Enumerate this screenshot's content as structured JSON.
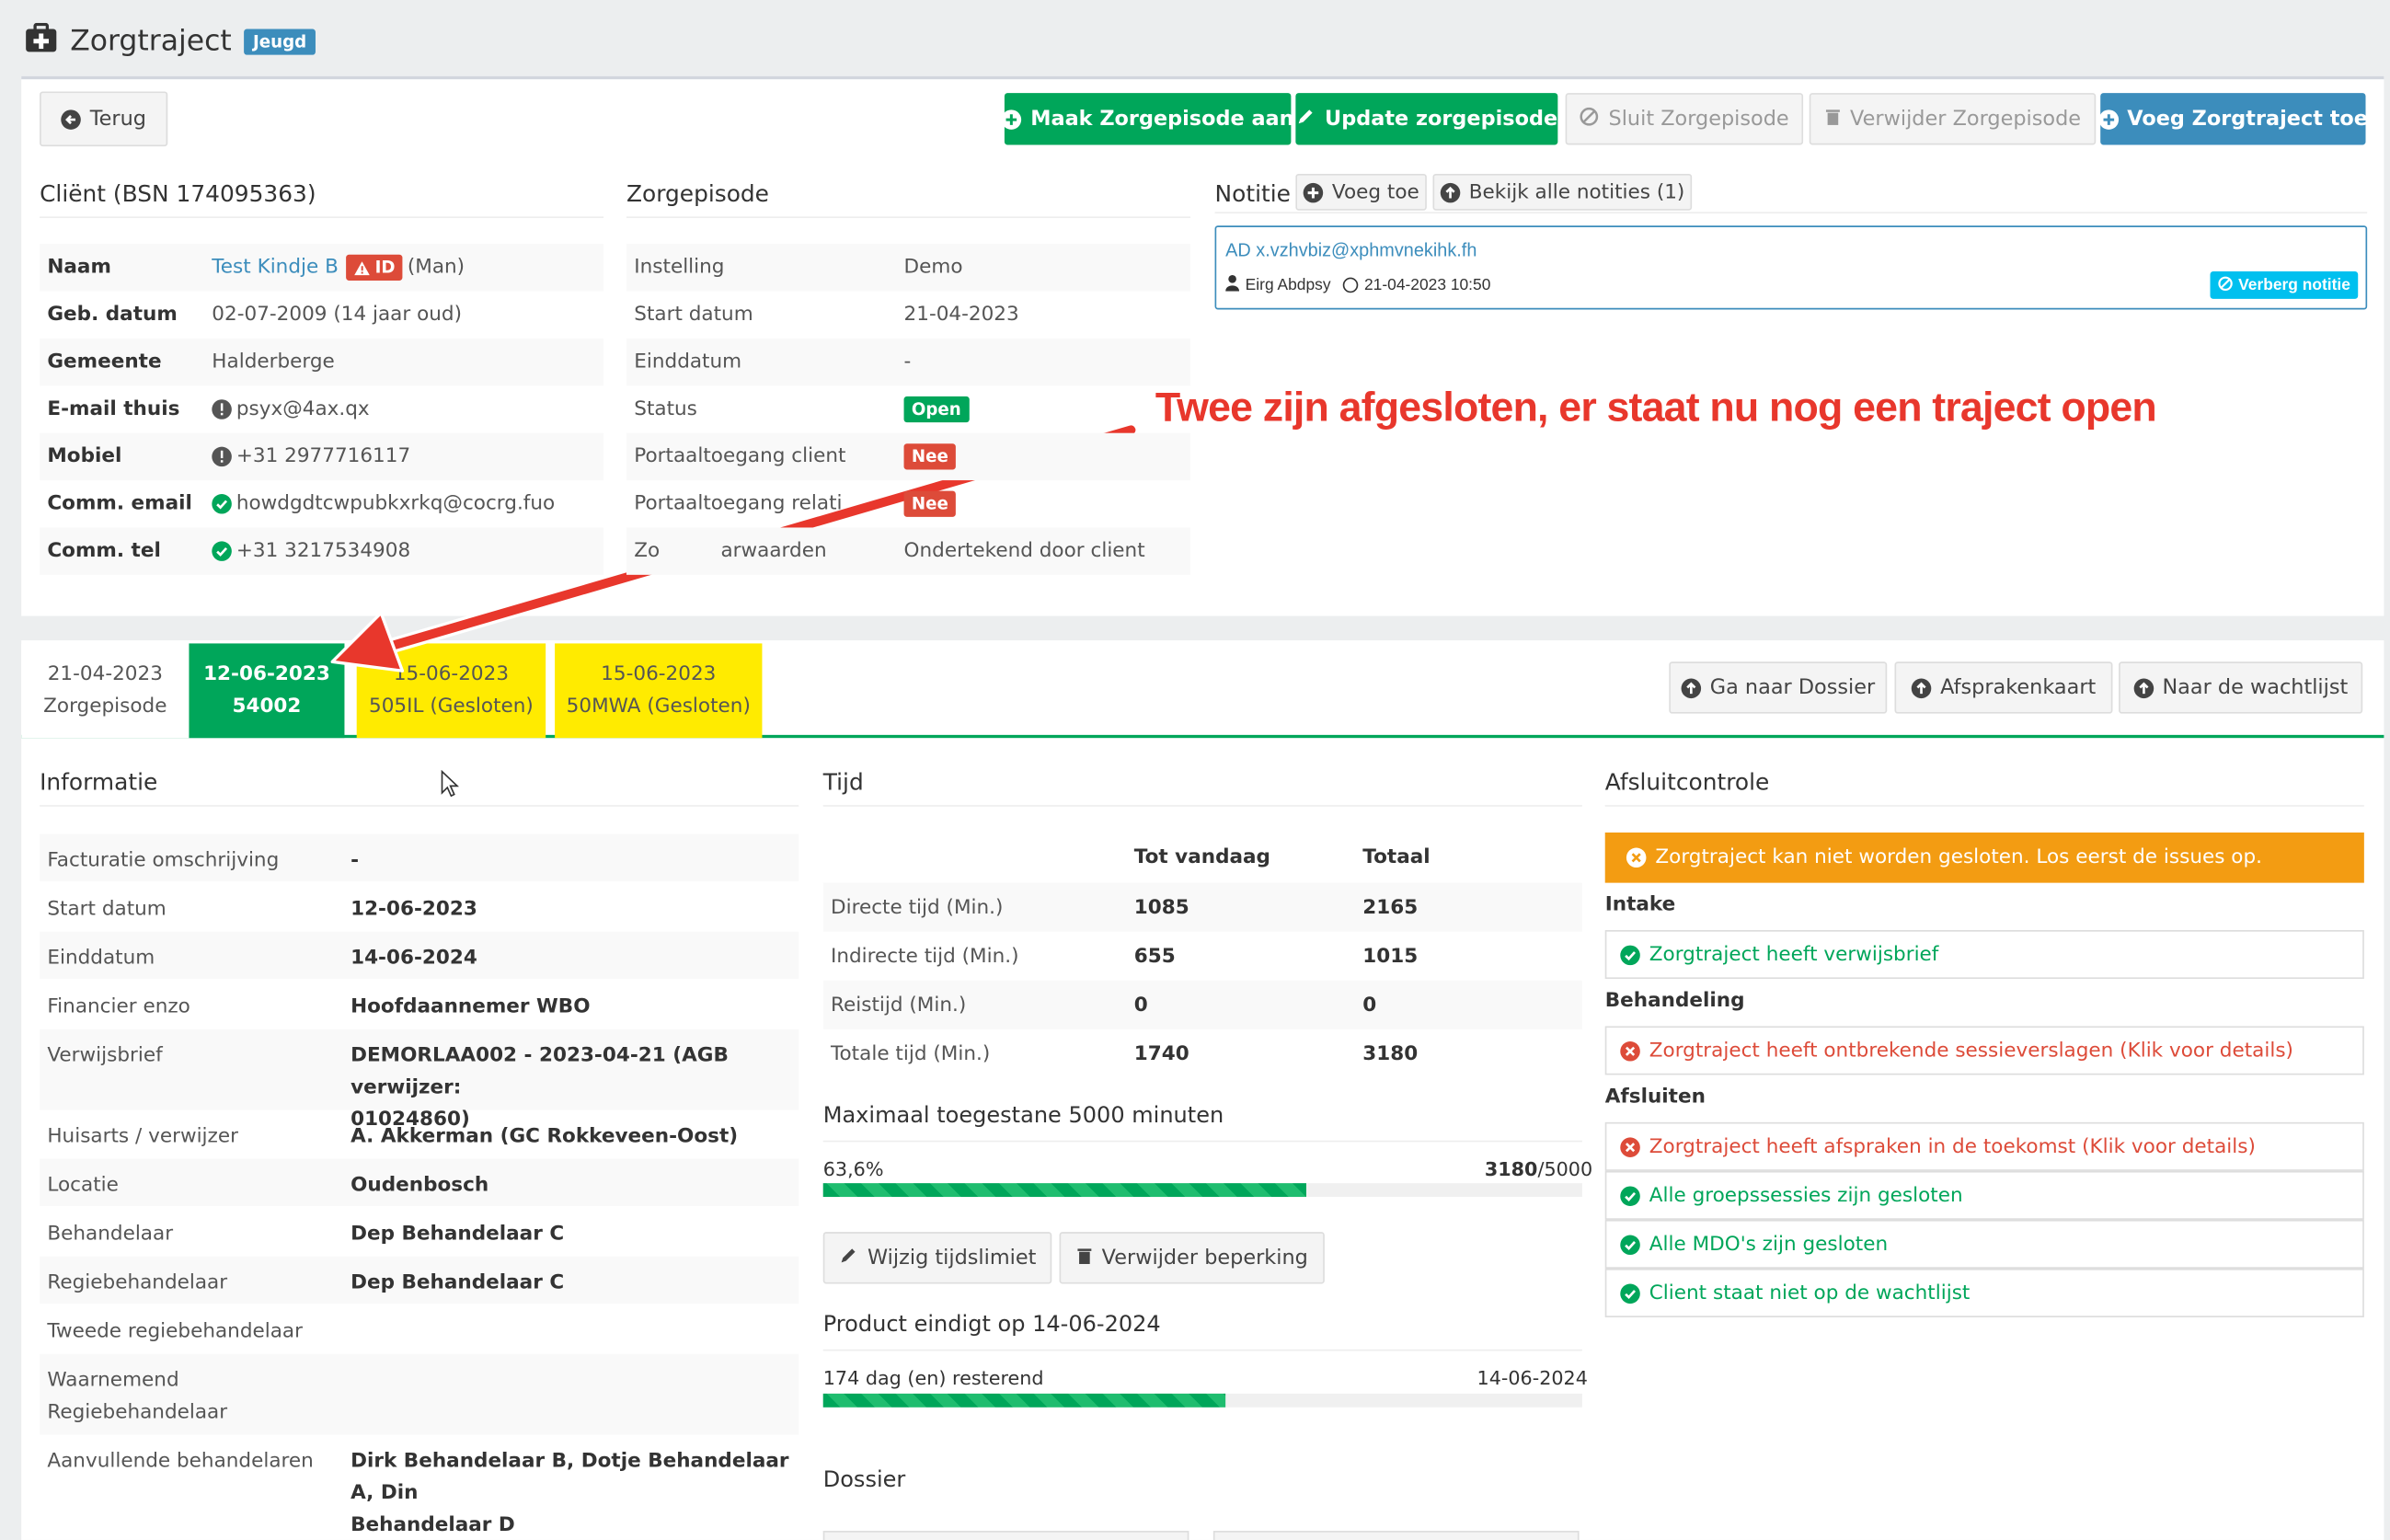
{
  "header": {
    "title": "Zorgtraject",
    "badge": "Jeugd"
  },
  "toolbar": {
    "back": "Terug",
    "create_episode": "Maak Zorgepisode aan",
    "update_episode": "Update zorgepisode",
    "close_episode": "Sluit Zorgepisode",
    "delete_episode": "Verwijder Zorgepisode",
    "add_trajectory": "Voeg Zorgtraject toe"
  },
  "client": {
    "title": "Cliënt (BSN 174095363)",
    "rows": [
      {
        "key": "Naam",
        "value": "Test Kindje B",
        "badge": "ID",
        "extra": "(Man)"
      },
      {
        "key": "Geb. datum",
        "value": "02-07-2009 (14 jaar oud)"
      },
      {
        "key": "Gemeente",
        "value": "Halderberge"
      },
      {
        "key": "E-mail thuis",
        "value": "psyx@4ax.qx"
      },
      {
        "key": "Mobiel",
        "value": "+31 2977716117"
      },
      {
        "key": "Comm. email",
        "value": "howdgdtcwpubkxrkq@cocrg.fuo"
      },
      {
        "key": "Comm. tel",
        "value": "+31 3217534908"
      }
    ]
  },
  "episode": {
    "title": "Zorgepisode",
    "rows": [
      {
        "key": "Instelling",
        "value": "Demo"
      },
      {
        "key": "Start datum",
        "value": "21-04-2023"
      },
      {
        "key": "Einddatum",
        "value": "-"
      },
      {
        "key": "Status",
        "value": "Open"
      },
      {
        "key": "Portaaltoegang client",
        "value": "Nee"
      },
      {
        "key": "Portaaltoegang relati",
        "value": "Nee"
      },
      {
        "key": "Zo",
        "key2": "arwaarden",
        "value": "Ondertekend door client"
      }
    ]
  },
  "notes": {
    "title": "Notitie",
    "add": "Voeg toe",
    "view_all": "Bekijk alle notities (1)",
    "note_text": "AD x.vzhvbiz@xphmvnekihk.fh",
    "note_author": "Eirg Abdpsy",
    "note_date": "21-04-2023 10:50",
    "hide": "Verberg notitie"
  },
  "annotation": "Twee zijn afgesloten, er staat nu nog een traject open",
  "tabs": [
    {
      "line1": "21-04-2023",
      "line2": "Zorgepisode"
    },
    {
      "line1": "12-06-2023",
      "line2": "54002"
    },
    {
      "line1": "15-06-2023",
      "line2": "505IL (Gesloten)"
    },
    {
      "line1": "15-06-2023",
      "line2": "50MWA (Gesloten)"
    }
  ],
  "actions": {
    "dossier": "Ga naar Dossier",
    "appointments": "Afsprakenkaart",
    "waitlist": "Naar de wachtlijst"
  },
  "info": {
    "title": "Informatie",
    "rows": [
      {
        "key": "Facturatie omschrijving",
        "value": "-"
      },
      {
        "key": "Start datum",
        "value": "12-06-2023"
      },
      {
        "key": "Einddatum",
        "value": "14-06-2024"
      },
      {
        "key": "Financier enzo",
        "value": "Hoofdaannemer WBO"
      },
      {
        "key": "Verwijsbrief",
        "value": "DEMORLAA002 - 2023-04-21 (AGB verwijzer:",
        "value2": "01024860)"
      },
      {
        "key": "Huisarts / verwijzer",
        "value": "A. Akkerman (GC Rokkeveen-Oost)"
      },
      {
        "key": "Locatie",
        "value": "Oudenbosch"
      },
      {
        "key": "Behandelaar",
        "value": "Dep Behandelaar C"
      },
      {
        "key": "Regiebehandelaar",
        "value": "Dep Behandelaar C"
      },
      {
        "key": "Tweede regiebehandelaar",
        "value": ""
      },
      {
        "key": "Waarnemend",
        "key2": "Regiebehandelaar",
        "value": ""
      },
      {
        "key": "Aanvullende behandelaren",
        "value": "Dirk Behandelaar B, Dotje Behandelaar A, Din",
        "value2": "Behandelaar D"
      }
    ]
  },
  "time": {
    "title": "Tijd",
    "col1": "Tot vandaag",
    "col2": "Totaal",
    "rows": [
      {
        "key": "Directe tijd (Min.)",
        "today": "1085",
        "total": "2165"
      },
      {
        "key": "Indirecte tijd (Min.)",
        "today": "655",
        "total": "1015"
      },
      {
        "key": "Reistijd (Min.)",
        "today": "0",
        "total": "0"
      },
      {
        "key": "Totale tijd (Min.)",
        "today": "1740",
        "total": "3180"
      }
    ],
    "max_title": "Maximaal toegestane 5000 minuten",
    "percent_label": "63,6%",
    "used": "3180",
    "limit": "/5000",
    "progress_fraction": 0.636,
    "edit_limit": "Wijzig tijdslimiet",
    "remove_limit": "Verwijder beperking",
    "product_title": "Product eindigt op 14-06-2024",
    "remaining": "174 dag (en) resterend",
    "end_date": "14-06-2024",
    "product_fraction": 0.53,
    "dossier_title": "Dossier"
  },
  "closing": {
    "title": "Afsluitcontrole",
    "warning": "Zorgtraject kan niet worden gesloten. Los eerst de issues op.",
    "intake": "Intake",
    "intake_items": [
      "Zorgtraject heeft verwijsbrief"
    ],
    "treatment": "Behandeling",
    "treatment_items": [
      "Zorgtraject heeft ontbrekende sessieverslagen (Klik voor details)"
    ],
    "close": "Afsluiten",
    "close_items": [
      "Zorgtraject heeft afspraken in de toekomst (Klik voor details)",
      "Alle groepssessies zijn gesloten",
      "Alle MDO's zijn gesloten",
      "Client staat niet op de wachtlijst"
    ]
  },
  "colors": {
    "green": "#00a65a",
    "blue": "#3c8dbc",
    "red": "#dd4b39",
    "orange": "#f39c12",
    "yellow": "#ffeb00"
  }
}
